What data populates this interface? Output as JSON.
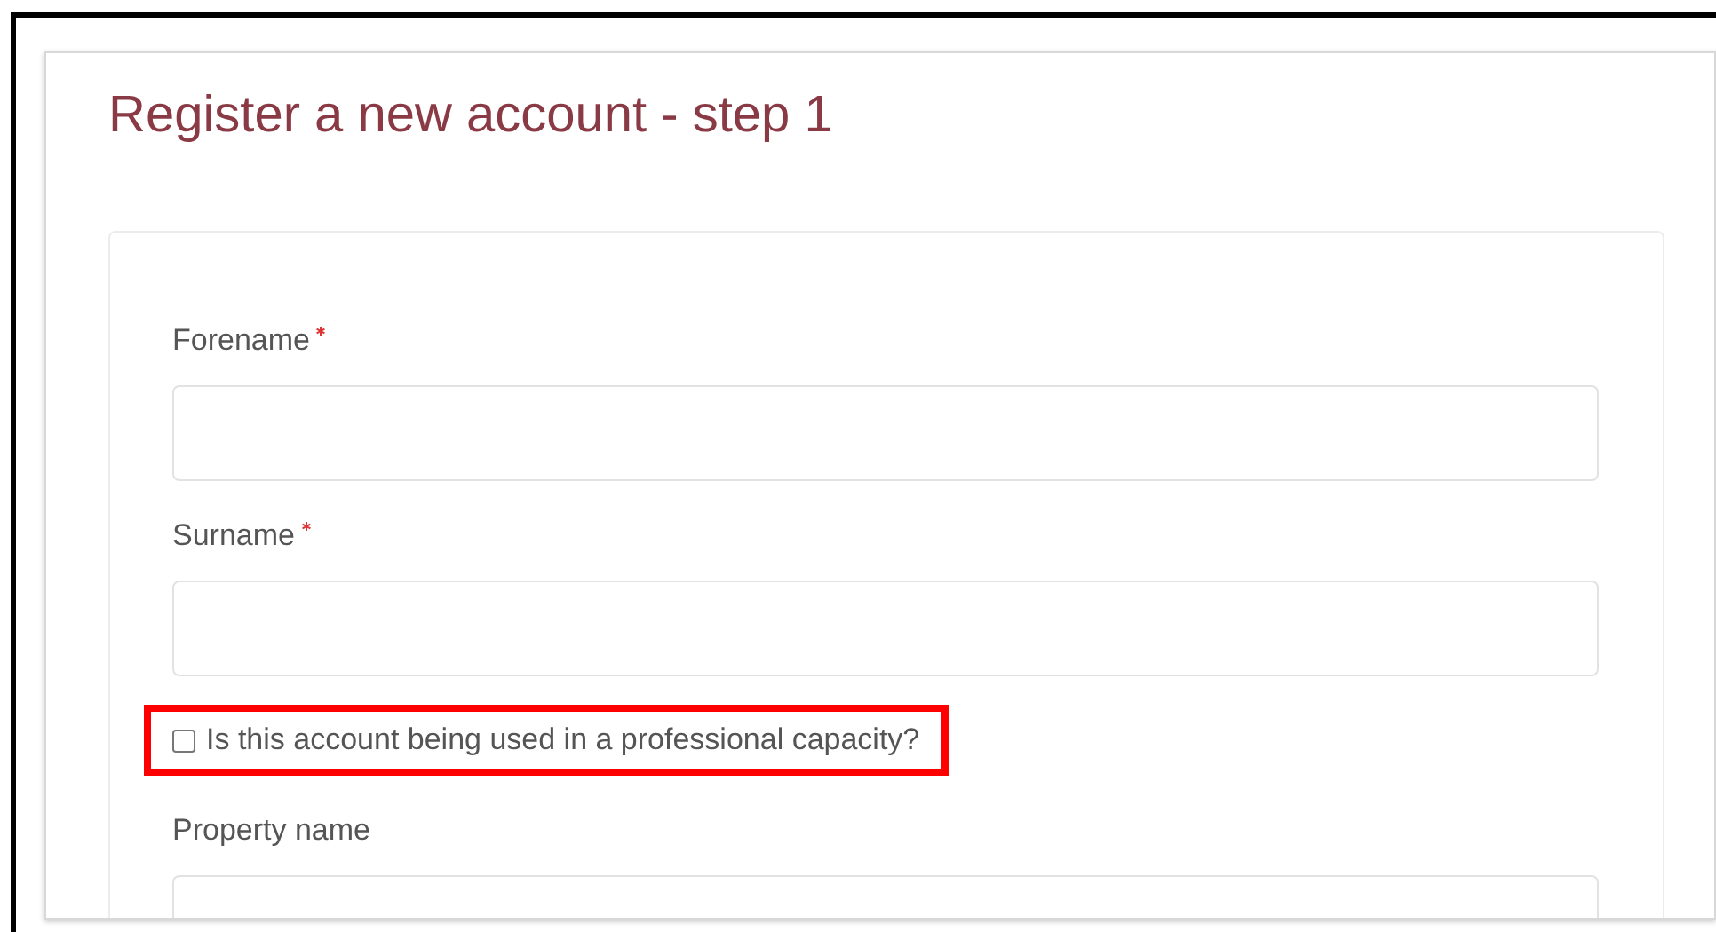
{
  "title": "Register a new account - step 1",
  "form": [
    {
      "kind": "text",
      "label": "Forename",
      "required": true
    },
    {
      "kind": "text",
      "label": "Surname",
      "required": true
    },
    {
      "kind": "checkbox",
      "label": "Is this account being used in a professional capacity?",
      "checked": false,
      "highlighted": true
    },
    {
      "kind": "text",
      "label": "Property name",
      "required": false
    }
  ]
}
